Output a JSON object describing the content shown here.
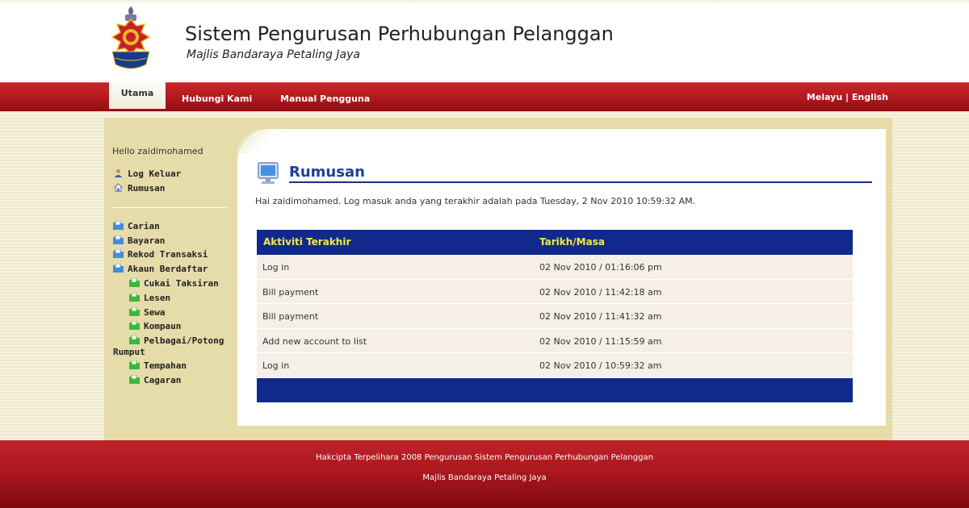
{
  "header": {
    "title": "Sistem Pengurusan Perhubungan Pelanggan",
    "subtitle": "Majlis Bandaraya Petaling Jaya"
  },
  "nav": {
    "tabs": [
      {
        "label": "Utama"
      },
      {
        "label": "Hubungi Kami"
      },
      {
        "label": "Manual Pengguna"
      }
    ],
    "lang_melayu": "Melayu",
    "lang_sep": " | ",
    "lang_english": "English"
  },
  "sidebar": {
    "hello": "Hello zaidimohamed",
    "top_items": [
      {
        "label": "Log Keluar",
        "icon": "user-icon"
      },
      {
        "label": "Rumusan",
        "icon": "home-icon"
      }
    ],
    "items": [
      {
        "label": "Carian"
      },
      {
        "label": "Bayaran"
      },
      {
        "label": "Rekod Transaksi"
      },
      {
        "label": "Akaun Berdaftar"
      }
    ],
    "sub_items": [
      {
        "label": "Cukai Taksiran"
      },
      {
        "label": "Lesen"
      },
      {
        "label": "Sewa"
      },
      {
        "label": "Kompaun"
      },
      {
        "label": "Pelbagai/Potong"
      },
      {
        "label": "Rumput"
      },
      {
        "label": "Tempahan"
      },
      {
        "label": "Cagaran"
      }
    ]
  },
  "main": {
    "title": "Rumusan",
    "welcome": "Hai zaidimohamed. Log masuk anda yang terakhir adalah pada Tuesday, 2 Nov 2010 10:59:32 AM.",
    "table": {
      "headers": [
        "Aktiviti Terakhir",
        "Tarikh/Masa"
      ],
      "rows": [
        [
          "Log in",
          "02 Nov 2010 / 01:16:06 pm"
        ],
        [
          "Bill payment",
          "02 Nov 2010 / 11:42:18 am"
        ],
        [
          "Bill payment",
          "02 Nov 2010 / 11:41:32 am"
        ],
        [
          "Add new account to list",
          "02 Nov 2010 / 11:15:59 am"
        ],
        [
          "Log in",
          "02 Nov 2010 / 10:59:32 am"
        ]
      ]
    }
  },
  "footer": {
    "line1": "Hakcipta Terpelihara 2008 Pengurusan Sistem Pengurusan Perhubungan Pelanggan",
    "line2": "Majlis Bandaraya Petaling Jaya"
  },
  "colors": {
    "nav_red": "#b0181d",
    "table_header_blue": "#0f2a8a",
    "table_header_text": "#f5e94a",
    "title_blue": "#1e3f96"
  }
}
